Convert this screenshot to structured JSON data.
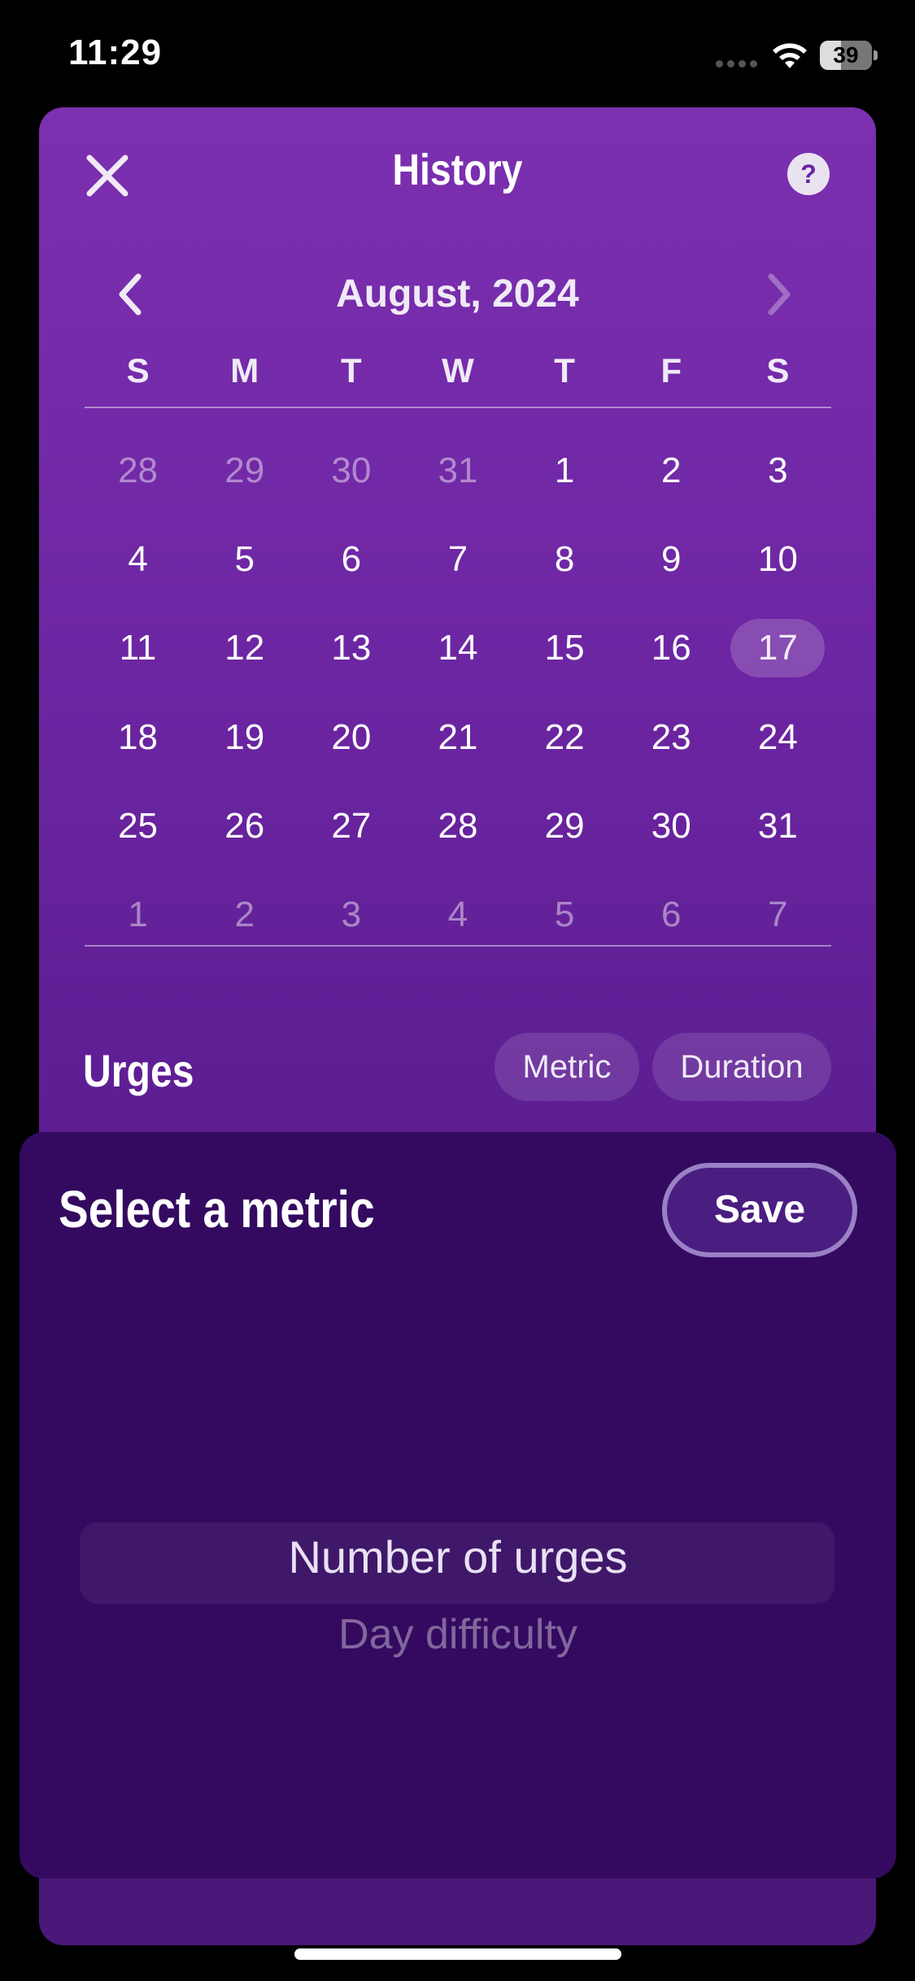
{
  "status_bar": {
    "time": "11:29",
    "battery": "39"
  },
  "header": {
    "title": "History"
  },
  "calendar": {
    "month_label": "August, 2024",
    "weekdays": [
      "S",
      "M",
      "T",
      "W",
      "T",
      "F",
      "S"
    ],
    "weeks": [
      [
        {
          "d": "28",
          "muted": true
        },
        {
          "d": "29",
          "muted": true
        },
        {
          "d": "30",
          "muted": true
        },
        {
          "d": "31",
          "muted": true
        },
        {
          "d": "1"
        },
        {
          "d": "2"
        },
        {
          "d": "3"
        }
      ],
      [
        {
          "d": "4"
        },
        {
          "d": "5"
        },
        {
          "d": "6"
        },
        {
          "d": "7"
        },
        {
          "d": "8"
        },
        {
          "d": "9"
        },
        {
          "d": "10"
        }
      ],
      [
        {
          "d": "11"
        },
        {
          "d": "12"
        },
        {
          "d": "13"
        },
        {
          "d": "14"
        },
        {
          "d": "15"
        },
        {
          "d": "16"
        },
        {
          "d": "17",
          "selected": true
        }
      ],
      [
        {
          "d": "18"
        },
        {
          "d": "19"
        },
        {
          "d": "20"
        },
        {
          "d": "21"
        },
        {
          "d": "22"
        },
        {
          "d": "23"
        },
        {
          "d": "24"
        }
      ],
      [
        {
          "d": "25"
        },
        {
          "d": "26"
        },
        {
          "d": "27"
        },
        {
          "d": "28"
        },
        {
          "d": "29"
        },
        {
          "d": "30"
        },
        {
          "d": "31"
        }
      ],
      [
        {
          "d": "1",
          "muted": true
        },
        {
          "d": "2",
          "muted": true
        },
        {
          "d": "3",
          "muted": true
        },
        {
          "d": "4",
          "muted": true
        },
        {
          "d": "5",
          "muted": true
        },
        {
          "d": "6",
          "muted": true
        },
        {
          "d": "7",
          "muted": true
        }
      ]
    ]
  },
  "urges": {
    "title": "Urges",
    "metric_label": "Metric",
    "duration_label": "Duration"
  },
  "modal": {
    "title": "Select a metric",
    "save_label": "Save",
    "options": [
      "Number of urges",
      "Day difficulty"
    ],
    "selected_option": "Number of urges"
  },
  "colors": {
    "sheet_top": "#7c30b0",
    "modal_bg": "#340a60",
    "save_border": "#9a80c6"
  }
}
